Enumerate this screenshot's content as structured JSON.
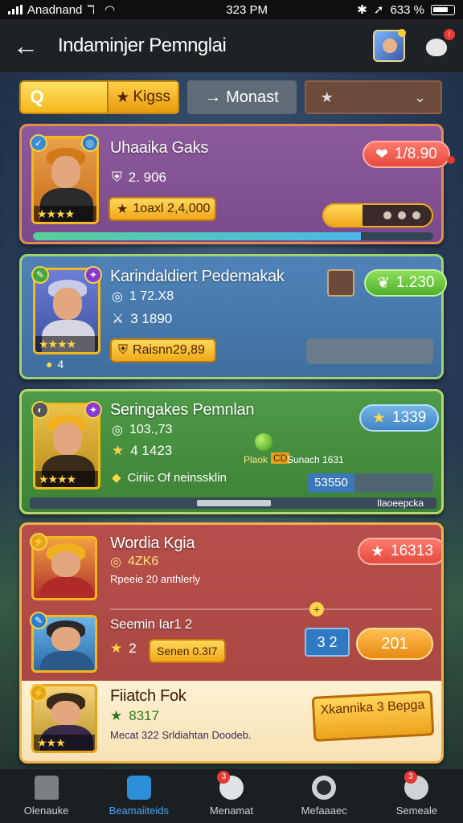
{
  "status_bar": {
    "carrier": "Anadnand",
    "time": "323 PM",
    "battery": "633 %"
  },
  "header": {
    "title": "Indaminjer Pemnglai"
  },
  "filters": {
    "kings_label": "Kigss",
    "monast_label": "Monast"
  },
  "cards": [
    {
      "name": "Uhaaika Gaks",
      "stat_value": "2. 906",
      "gold_label": "1oaxl 2,4,000",
      "price": "1/8.90",
      "progress": 0.82
    },
    {
      "name": "Karindaldiert Pedemakak",
      "sub_value": "1 72.X8",
      "stat_value": "3 1890",
      "gold_label": "Raisnn29,89",
      "coins": "4",
      "price": "1.230"
    },
    {
      "name": "Seringakes Pemnlan",
      "sub_value": "103.,73",
      "stat_value": "4 1423",
      "detail": "Ciriic Of neinssklin",
      "mid_left": "Plaok",
      "mid_mid": "CD",
      "mid_right": "Sunach 1631",
      "price": "1339",
      "box_value": "53550",
      "footer_label": "Ilaoeepcka"
    },
    {
      "name": "Wordia Kgia",
      "sub_value": "4ZK6",
      "detail": "Rpeeie 20 anthlerly",
      "price": "16313",
      "second_name": "Seemin Iar1 2",
      "second_stat": "2",
      "second_pill": "Senen 0.3I7",
      "blue_button": "3 2",
      "orange_button": "201",
      "third_name": "Fiiatch Fok",
      "third_value": "8317",
      "third_detail": "Mecat 322 Srldiahtan Doodeb.",
      "banner_text": "Xkannika 3 Bepga"
    }
  ],
  "nav": [
    {
      "label": "Olenauke",
      "icon": "home-icon",
      "active": false,
      "badge": ""
    },
    {
      "label": "Beamaiiteids",
      "icon": "tools-icon",
      "active": true,
      "badge": ""
    },
    {
      "label": "Menamat",
      "icon": "message-icon",
      "active": false,
      "badge": "3"
    },
    {
      "label": "Mefaaaec",
      "icon": "gear-icon",
      "active": false,
      "badge": ""
    },
    {
      "label": "Semeale",
      "icon": "profile-icon",
      "active": false,
      "badge": "3"
    }
  ]
}
